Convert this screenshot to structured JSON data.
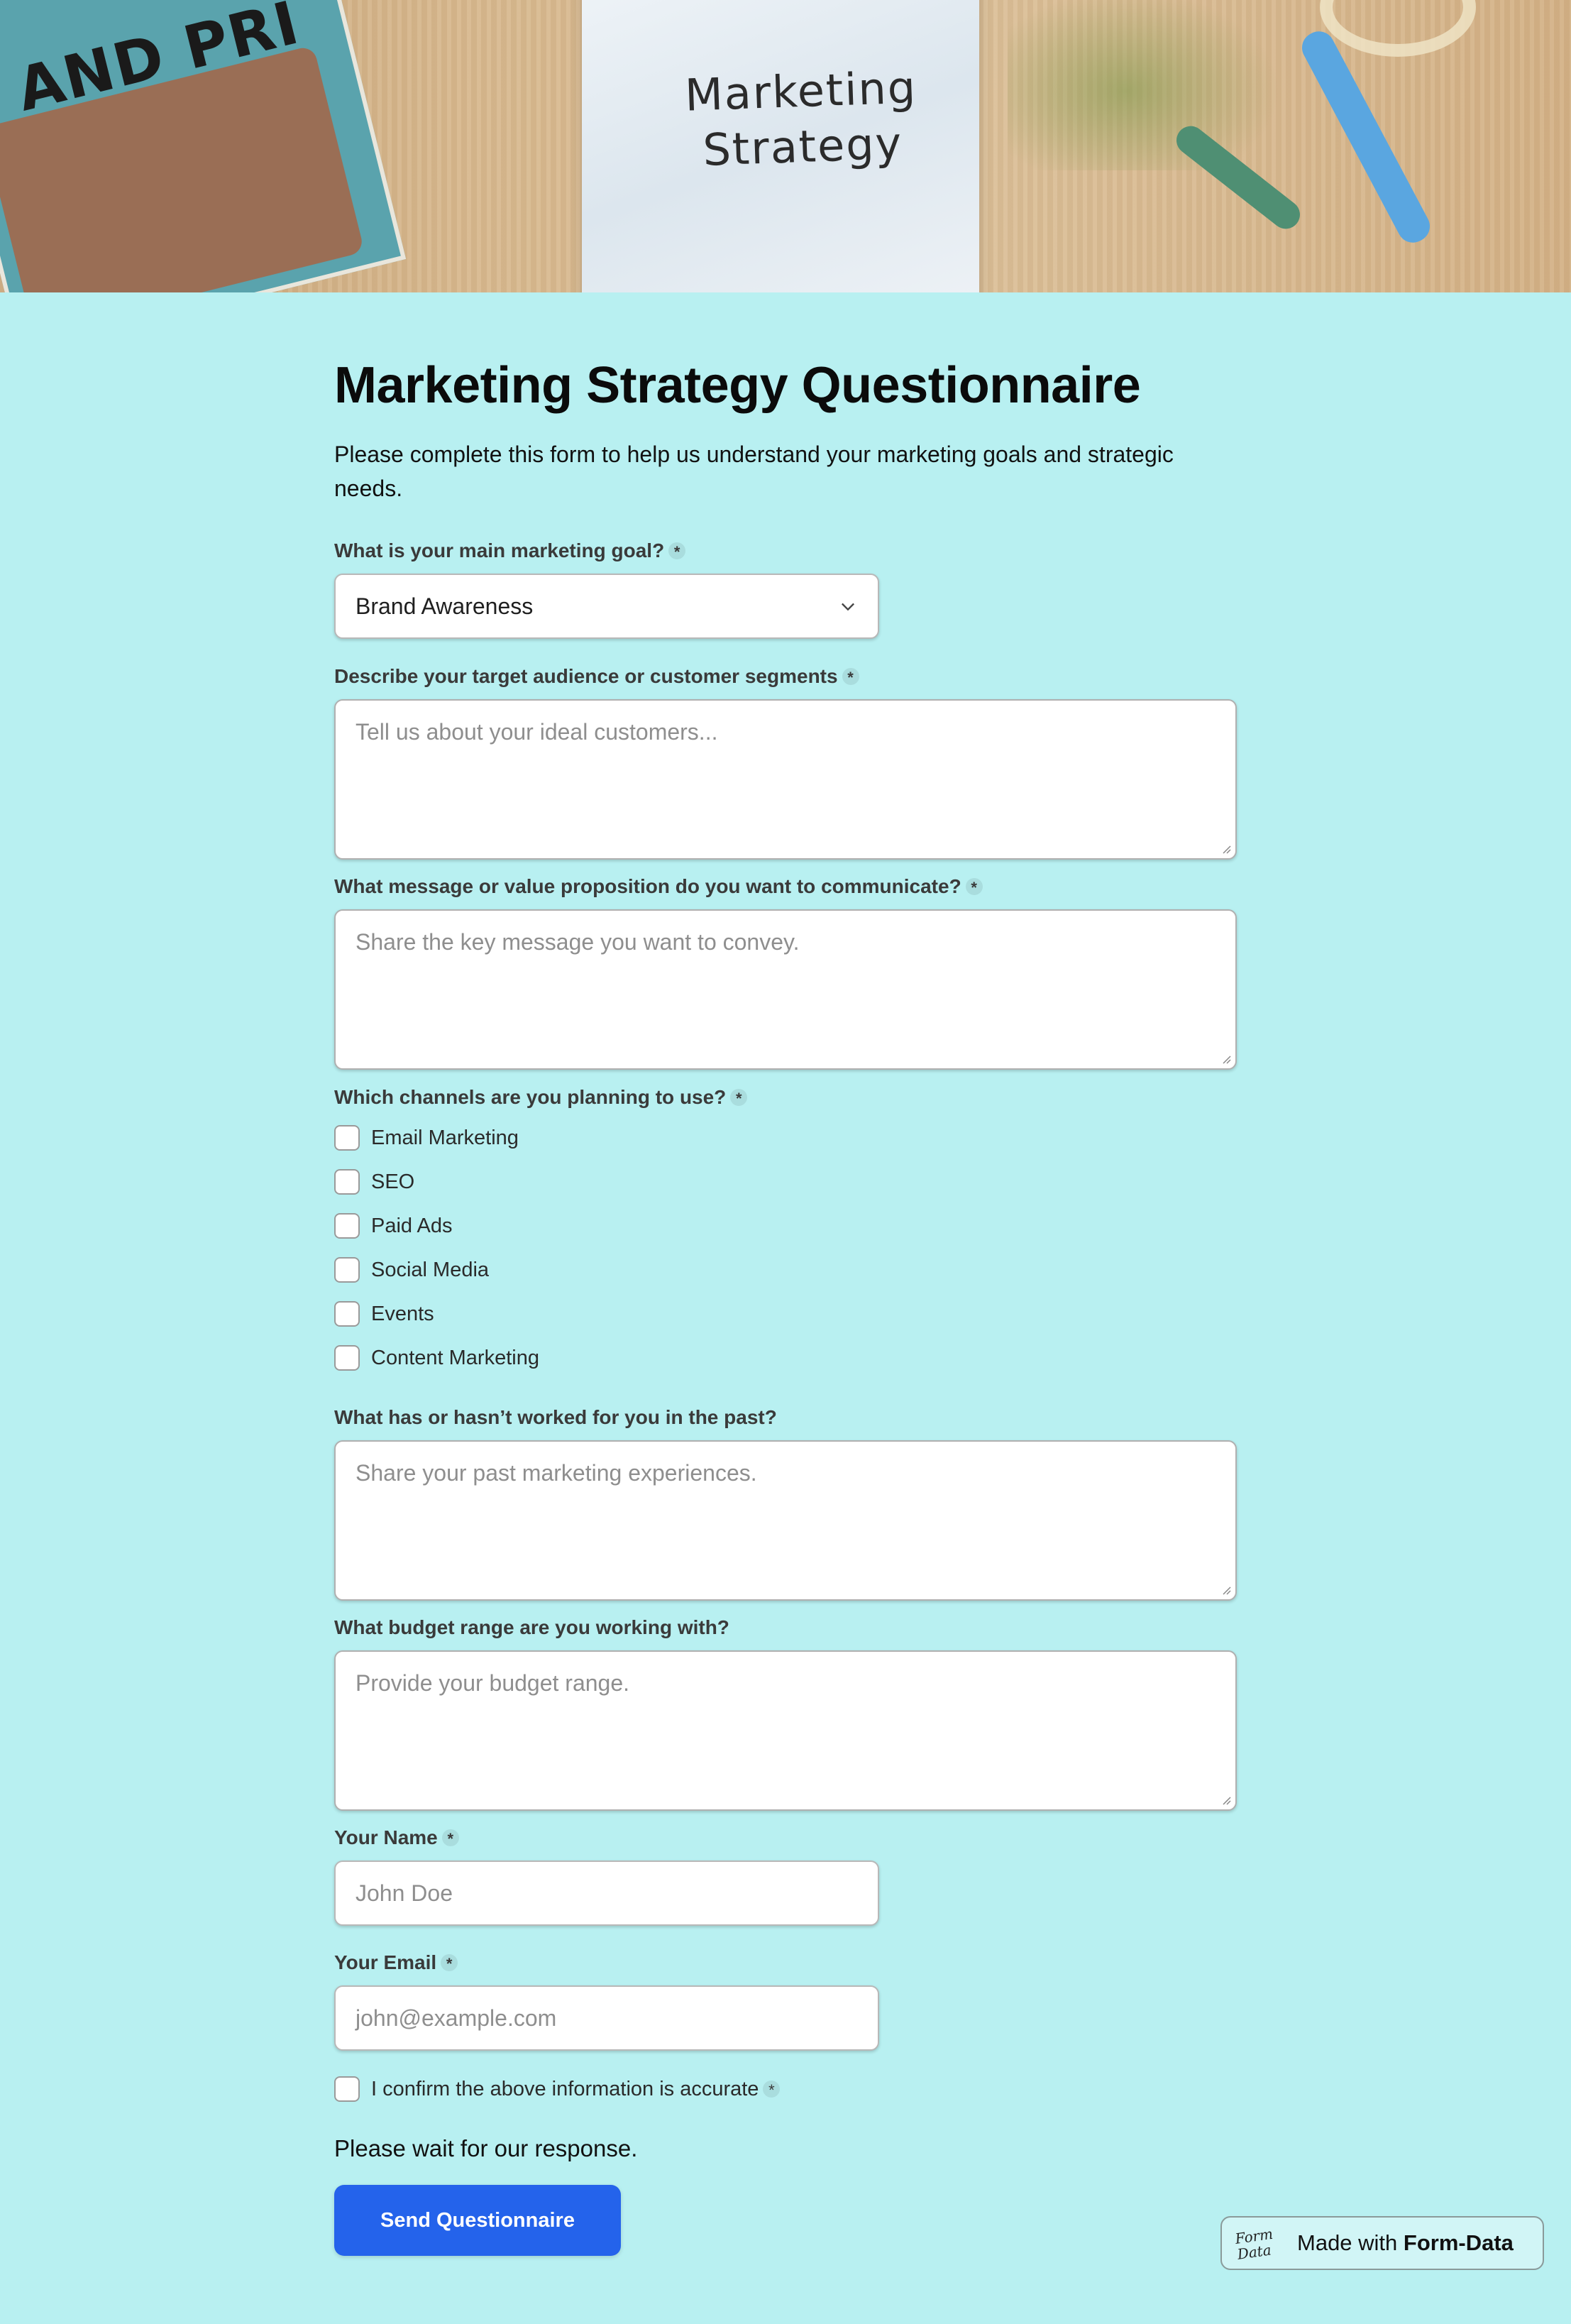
{
  "hero": {
    "book_title": "AND PRI",
    "paper_text_line1": "Marketing",
    "paper_text_line2": "Strategy"
  },
  "form": {
    "title": "Marketing Strategy Questionnaire",
    "subtitle": "Please complete this form to help us understand your marketing goals and strategic needs.",
    "required_mark": "*",
    "goal": {
      "label": "What is your main marketing goal?",
      "selected": "Brand Awareness"
    },
    "audience": {
      "label": "Describe your target audience or customer segments",
      "placeholder": "Tell us about your ideal customers..."
    },
    "message": {
      "label": "What message or value proposition do you want to communicate?",
      "placeholder": "Share the key message you want to convey."
    },
    "channels": {
      "label": "Which channels are you planning to use?",
      "options": [
        "Email Marketing",
        "SEO",
        "Paid Ads",
        "Social Media",
        "Events",
        "Content Marketing"
      ]
    },
    "past": {
      "label": "What has or hasn’t worked for you in the past?",
      "placeholder": "Share your past marketing experiences."
    },
    "budget": {
      "label": "What budget range are you working with?",
      "placeholder": "Provide your budget range."
    },
    "name": {
      "label": "Your Name",
      "placeholder": "John Doe"
    },
    "email": {
      "label": "Your Email",
      "placeholder": "john@example.com"
    },
    "confirm": {
      "label": "I confirm the above information is accurate"
    },
    "wait_text": "Please wait for our response.",
    "submit_label": "Send Questionnaire"
  },
  "badge": {
    "logo_line1": "Form",
    "logo_line2": "Data",
    "prefix": "Made with",
    "brand": "Form-Data"
  },
  "colors": {
    "background": "#b8f0f1",
    "submit_button": "#2463eb"
  }
}
